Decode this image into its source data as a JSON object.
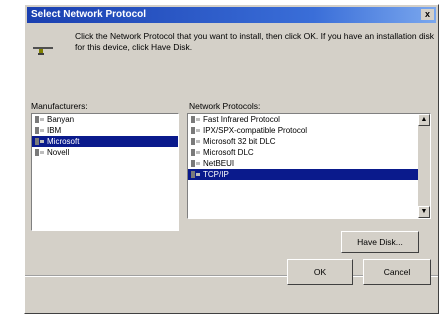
{
  "window": {
    "title": "Select Network Protocol",
    "close_glyph": "x"
  },
  "description": "Click the Network Protocol that you want to install, then click OK. If you have an installation disk for this device, click Have Disk.",
  "manufacturers": {
    "label": "Manufacturers:",
    "items": [
      {
        "label": "Banyan",
        "selected": false
      },
      {
        "label": "IBM",
        "selected": false
      },
      {
        "label": "Microsoft",
        "selected": true
      },
      {
        "label": "Novell",
        "selected": false
      }
    ]
  },
  "protocols": {
    "label": "Network Protocols:",
    "items": [
      {
        "label": "Fast Infrared Protocol",
        "selected": false
      },
      {
        "label": "IPX/SPX-compatible Protocol",
        "selected": false
      },
      {
        "label": "Microsoft 32 bit DLC",
        "selected": false
      },
      {
        "label": "Microsoft DLC",
        "selected": false
      },
      {
        "label": "NetBEUI",
        "selected": false
      },
      {
        "label": "TCP/IP",
        "selected": true
      }
    ]
  },
  "buttons": {
    "have_disk": "Have Disk...",
    "ok": "OK",
    "cancel": "Cancel"
  },
  "colors": {
    "title_bar": "#1a3fb0",
    "selection": "#0a1a8c",
    "face": "#d4d0c8"
  },
  "icons": {
    "header": "network-cable-icon",
    "item": "network-protocol-icon"
  }
}
